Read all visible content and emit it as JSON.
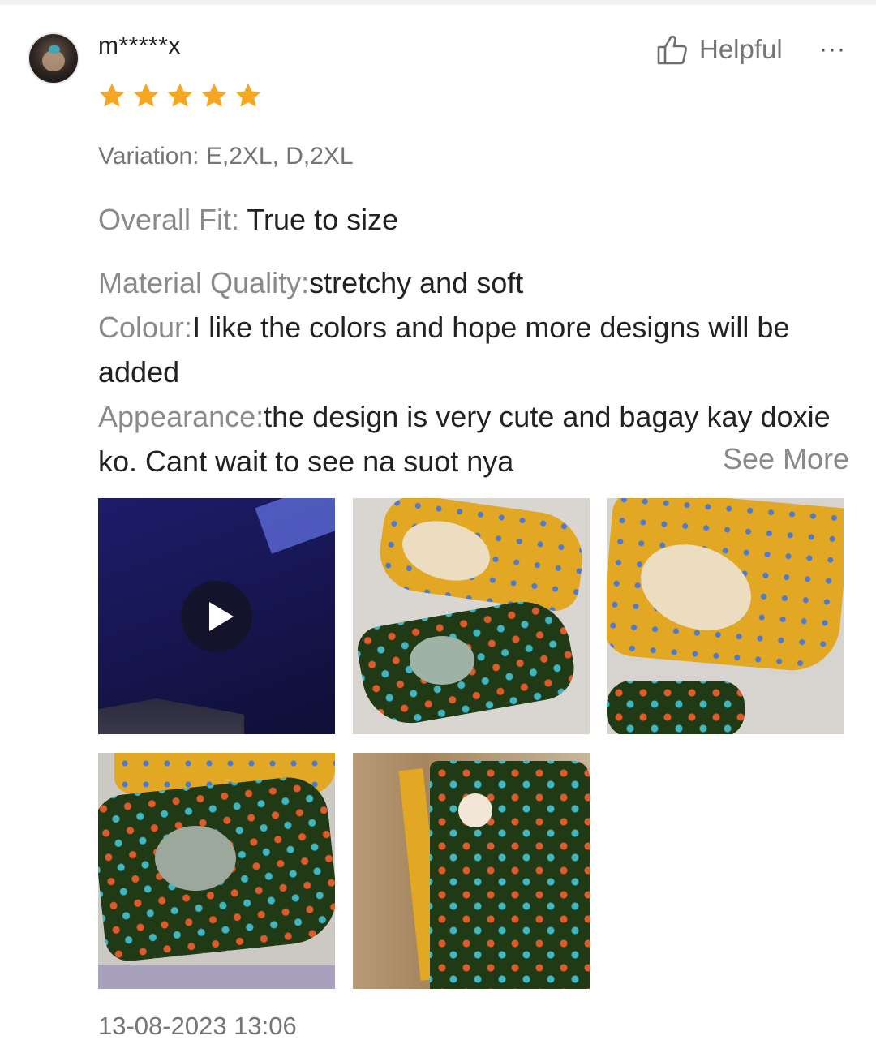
{
  "review": {
    "username": "m*****x",
    "rating": 5,
    "helpful_label": "Helpful",
    "more_label": "···",
    "variation": "Variation: E,2XL, D,2XL",
    "overall_fit": {
      "label": "Overall Fit: ",
      "value": "True to size"
    },
    "attributes": [
      {
        "label": "Material Quality:",
        "value": "stretchy and soft"
      },
      {
        "label": "Colour:",
        "value": "I like the colors and hope more designs will be added"
      },
      {
        "label": "Appearance:",
        "value": "the design is very cute and bagay kay doxie ko. Cant wait to see na suot nya"
      }
    ],
    "see_more": "See More",
    "media": [
      {
        "type": "video",
        "icon": "play-icon"
      },
      {
        "type": "image"
      },
      {
        "type": "image"
      },
      {
        "type": "image"
      },
      {
        "type": "image"
      }
    ],
    "date": "13-08-2023 13:06"
  },
  "colors": {
    "star": "#f5a623",
    "muted_text": "#757575",
    "text": "#222222"
  }
}
